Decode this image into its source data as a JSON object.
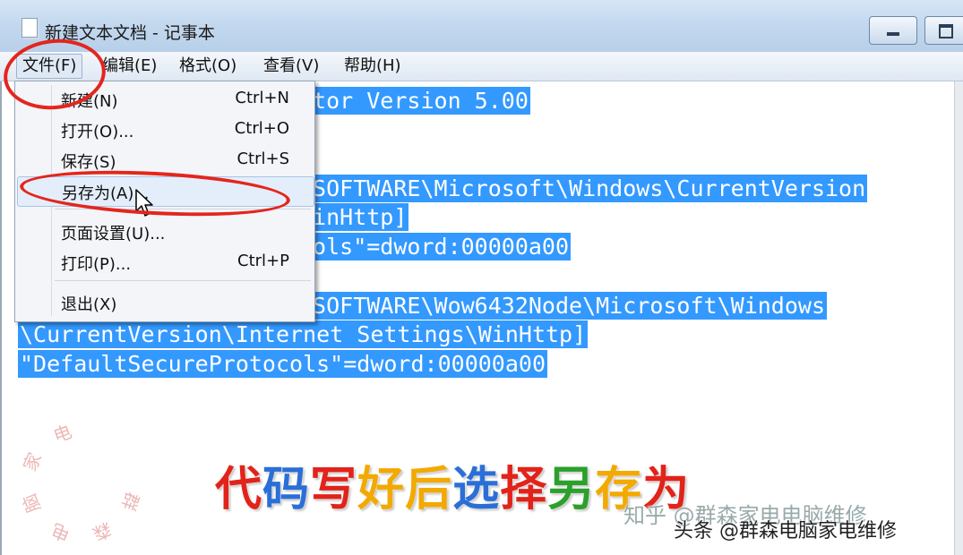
{
  "window": {
    "title": "新建文本文档 - 记事本"
  },
  "menubar": {
    "items": [
      "文件(F)",
      "编辑(E)",
      "格式(O)",
      "查看(V)",
      "帮助(H)"
    ]
  },
  "file_menu": {
    "items": [
      {
        "label": "新建(N)",
        "shortcut": "Ctrl+N"
      },
      {
        "label": "打开(O)...",
        "shortcut": "Ctrl+O"
      },
      {
        "label": "保存(S)",
        "shortcut": "Ctrl+S"
      },
      {
        "label": "另存为(A)...",
        "shortcut": ""
      },
      {
        "label": "页面设置(U)...",
        "shortcut": ""
      },
      {
        "label": "打印(P)...",
        "shortcut": "Ctrl+P"
      },
      {
        "label": "退出(X)",
        "shortcut": ""
      }
    ]
  },
  "editor": {
    "lines": [
      "itor Version 5.00",
      "\\SOFTWARE\\Microsoft\\Windows\\CurrentVersion",
      "WinHttp]",
      "cols\"=dword:00000a00",
      "\\SOFTWARE\\Wow6432Node\\Microsoft\\Windows",
      "\\CurrentVersion\\Internet Settings\\WinHttp]",
      "\"DefaultSecureProtocols\"=dword:00000a00"
    ]
  },
  "caption": {
    "chars": [
      "代",
      "码",
      "写",
      "好",
      "后",
      "选",
      "择",
      "另",
      "存",
      "为"
    ],
    "colors": [
      "#e2231a",
      "#2b6fd6",
      "#e2231a",
      "#f2a900",
      "#f2a900",
      "#2b6fd6",
      "#e2231a",
      "#2ca02c",
      "#f2a900",
      "#e2231a"
    ]
  },
  "watermarks": {
    "zhihu": "知乎 @群森家电电脑维修",
    "attribution": "头条 @群森电脑家电维修",
    "stamp_text": "群森电脑家电"
  },
  "colors": {
    "selection": "#3399ff",
    "annotation": "#e3261d"
  }
}
